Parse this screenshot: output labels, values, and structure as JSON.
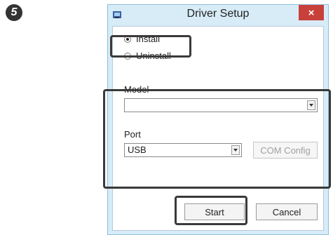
{
  "step": "5",
  "window": {
    "title": "Driver Setup",
    "close_label": "×"
  },
  "mode": {
    "install_label": "Install",
    "uninstall_label": "Uninstall",
    "selected": "install"
  },
  "model": {
    "label": "Model",
    "value": ""
  },
  "port": {
    "label": "Port",
    "value": "USB",
    "com_config_label": "COM Config"
  },
  "buttons": {
    "start_label": "Start",
    "cancel_label": "Cancel"
  },
  "colors": {
    "title_bar": "#d7ecf7",
    "close_button": "#c8403a",
    "highlight_border": "#3a3a3a"
  }
}
